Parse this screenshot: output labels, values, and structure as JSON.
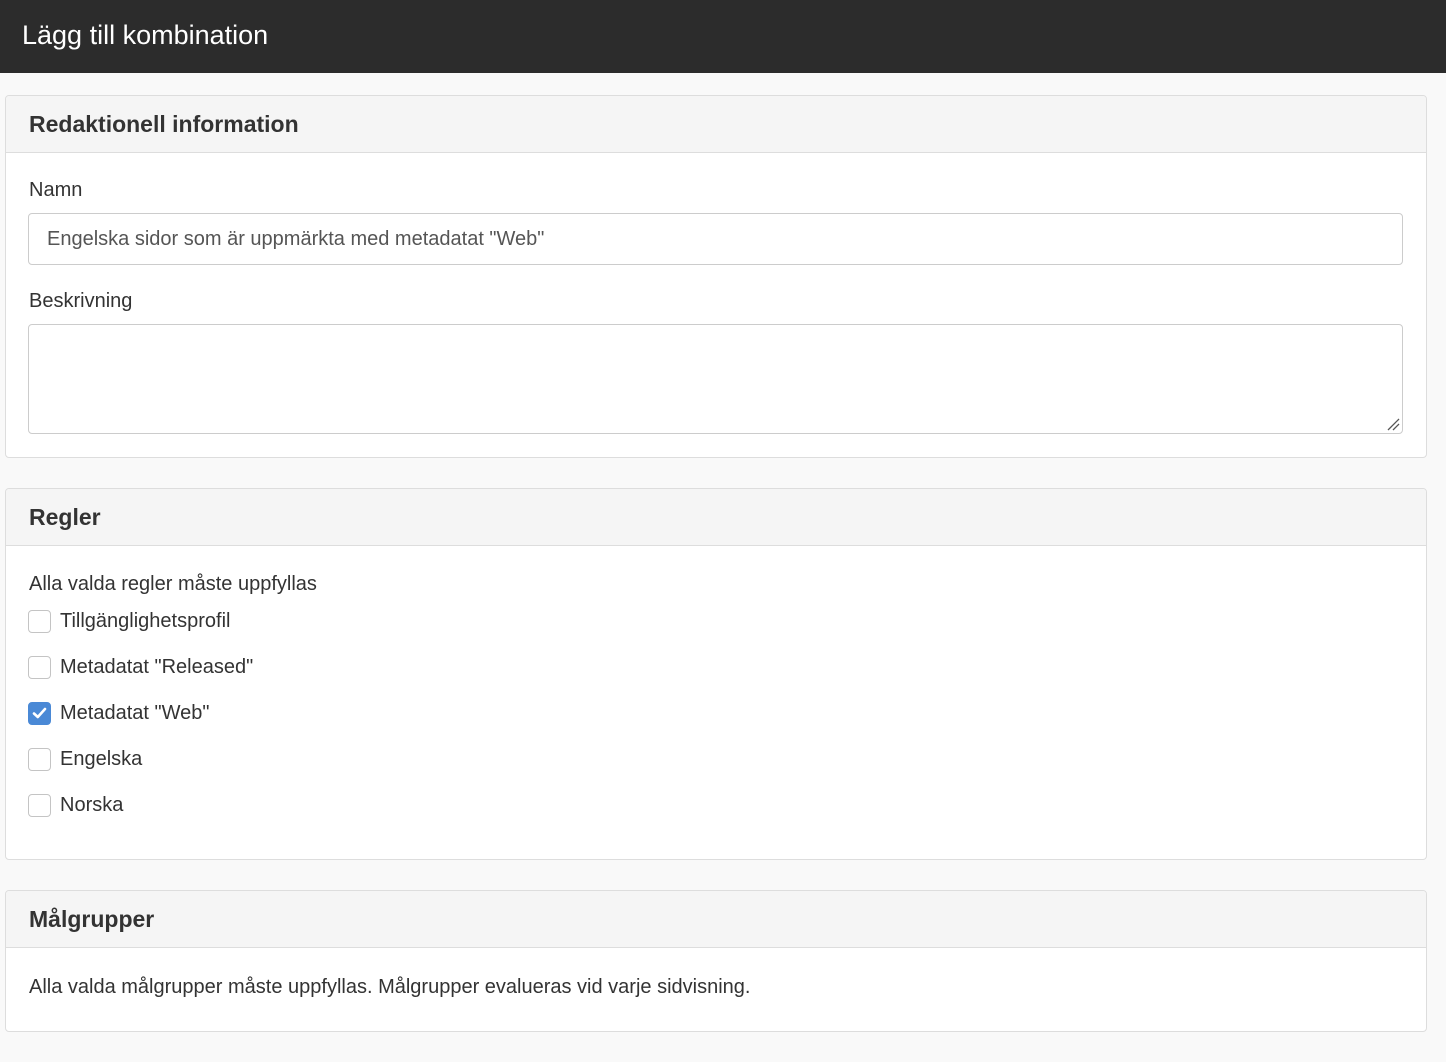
{
  "header": {
    "title": "Lägg till kombination"
  },
  "editorial": {
    "heading": "Redaktionell information",
    "name_label": "Namn",
    "name_value": "Engelska sidor som är uppmärkta med metadatat \"Web\"",
    "description_label": "Beskrivning",
    "description_value": ""
  },
  "rules": {
    "heading": "Regler",
    "help": "Alla valda regler måste uppfyllas",
    "items": [
      {
        "label": "Tillgänglighetsprofil",
        "checked": false
      },
      {
        "label": "Metadatat \"Released\"",
        "checked": false
      },
      {
        "label": "Metadatat \"Web\"",
        "checked": true
      },
      {
        "label": "Engelska",
        "checked": false
      },
      {
        "label": "Norska",
        "checked": false
      }
    ]
  },
  "audiences": {
    "heading": "Målgrupper",
    "help": "Alla valda målgrupper måste uppfyllas. Målgrupper evalueras vid varje sidvisning."
  },
  "colors": {
    "header_bg": "#2c2c2c",
    "checkbox_checked": "#4a89d6"
  }
}
